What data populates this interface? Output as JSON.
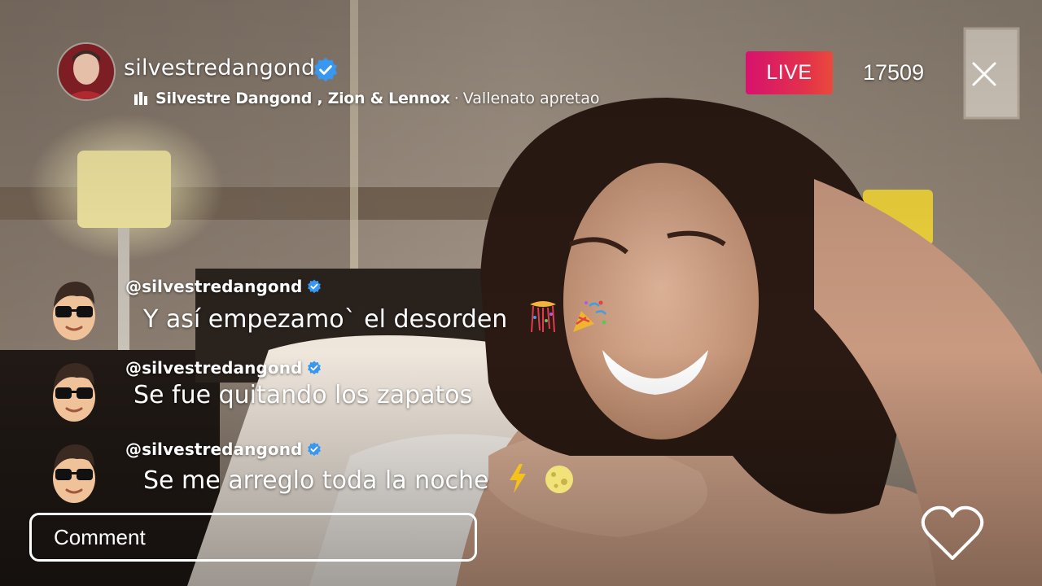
{
  "header": {
    "username": "silvestredangond",
    "music": {
      "artists": "Silvestre Dangond , Zion & Lennox",
      "separator": "·",
      "song": "Vallenato apretao"
    },
    "live_label": "LIVE",
    "viewer_count": "17509"
  },
  "comments": [
    {
      "username": "@silvestredangond",
      "text": "Y así empezamo` el desorden",
      "emojis": [
        "confetti-ball",
        "party-popper"
      ]
    },
    {
      "username": "@silvestredangond",
      "text": "Se fue quitando los zapatos",
      "emojis": []
    },
    {
      "username": "@silvestredangond",
      "text": "Se me arreglo toda la noche",
      "emojis": [
        "lightning",
        "moon-face"
      ]
    }
  ],
  "input": {
    "placeholder": "Comment"
  },
  "colors": {
    "live_gradient_start": "#d7126e",
    "live_gradient_end": "#ea4a3c",
    "verified_blue": "#3897f0",
    "text": "#ffffff"
  },
  "icons": [
    "verified-badge-icon",
    "music-bars-icon",
    "close-icon",
    "heart-icon"
  ]
}
